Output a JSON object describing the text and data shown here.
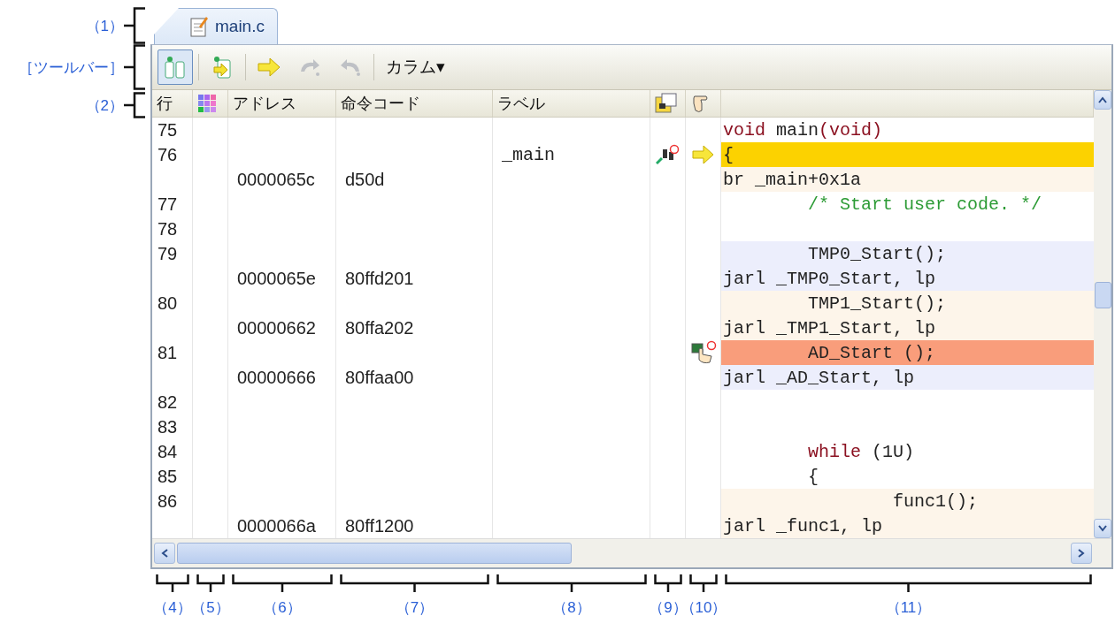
{
  "callouts_left": [
    "（1）",
    "［ツールバー］",
    "（2）"
  ],
  "tab": {
    "label": "main.c",
    "selected": true
  },
  "toolbar": [
    {
      "kind": "toggle",
      "selected": true,
      "disabled": false
    },
    {
      "kind": "button",
      "selected": false,
      "disabled": false
    },
    {
      "kind": "button",
      "selected": false,
      "disabled": false
    },
    {
      "kind": "button",
      "selected": false,
      "disabled": true
    },
    {
      "kind": "button",
      "selected": false,
      "disabled": true
    },
    {
      "kind": "menu",
      "label": "カラム",
      "caret": "▾",
      "selected": false,
      "disabled": false
    }
  ],
  "columns": [
    "行",
    "",
    "アドレス",
    "命令コード",
    "ラベル",
    "",
    "",
    ""
  ],
  "rows": [
    {
      "line": "75",
      "code": [
        {
          "t": "void",
          "kind": "keyword"
        },
        {
          "t": " main",
          "kind": "plain"
        },
        {
          "t": "(void)",
          "kind": "keyword"
        }
      ],
      "event": false,
      "current": false,
      "breakpoint": false
    },
    {
      "line": "76",
      "label": "_main",
      "code": [
        {
          "t": "{",
          "kind": "plain"
        }
      ],
      "color": "#fcd200",
      "event": true,
      "current": true,
      "breakpoint": false
    },
    {
      "address": "0000065c",
      "opcode": "d50d",
      "code": [
        {
          "t": "br _main+0x1a",
          "kind": "plain"
        }
      ],
      "color": "#fdf5ea",
      "event": false,
      "current": false,
      "breakpoint": false
    },
    {
      "line": "77",
      "code": [
        {
          "t": "        /* Start user code. */",
          "kind": "comment"
        }
      ],
      "event": false,
      "current": false,
      "breakpoint": false
    },
    {
      "line": "78",
      "event": false,
      "current": false,
      "breakpoint": false
    },
    {
      "line": "79",
      "code": [
        {
          "t": "        TMP0_Start();",
          "kind": "plain"
        }
      ],
      "color": "#eceefc",
      "event": false,
      "current": false,
      "breakpoint": false
    },
    {
      "address": "0000065e",
      "opcode": "80ffd201",
      "code": [
        {
          "t": "jarl _TMP0_Start, lp",
          "kind": "plain"
        }
      ],
      "color": "#eceefc",
      "event": false,
      "current": false,
      "breakpoint": false
    },
    {
      "line": "80",
      "code": [
        {
          "t": "        TMP1_Start();",
          "kind": "plain"
        }
      ],
      "color": "#fdf5ea",
      "event": false,
      "current": false,
      "breakpoint": false
    },
    {
      "address": "00000662",
      "opcode": "80ffa202",
      "code": [
        {
          "t": "jarl _TMP1_Start, lp",
          "kind": "plain"
        }
      ],
      "color": "#fdf5ea",
      "event": false,
      "current": false,
      "breakpoint": false
    },
    {
      "line": "81",
      "code": [
        {
          "t": "        AD_Start ();",
          "kind": "plain"
        }
      ],
      "color": "#f99d7b",
      "event": false,
      "current": false,
      "breakpoint": true
    },
    {
      "address": "00000666",
      "opcode": "80ffaa00",
      "code": [
        {
          "t": "jarl _AD_Start, lp",
          "kind": "plain"
        }
      ],
      "color": "#eceefc",
      "event": false,
      "current": false,
      "breakpoint": false
    },
    {
      "line": "82",
      "event": false,
      "current": false,
      "breakpoint": false
    },
    {
      "line": "83",
      "event": false,
      "current": false,
      "breakpoint": false
    },
    {
      "line": "84",
      "code": [
        {
          "t": "        while",
          "kind": "keyword"
        },
        {
          "t": " (1U)",
          "kind": "plain"
        }
      ],
      "event": false,
      "current": false,
      "breakpoint": false
    },
    {
      "line": "85",
      "code": [
        {
          "t": "        {",
          "kind": "plain"
        }
      ],
      "event": false,
      "current": false,
      "breakpoint": false
    },
    {
      "line": "86",
      "code": [
        {
          "t": "                func1();",
          "kind": "plain"
        }
      ],
      "color": "#fdf5ea",
      "event": false,
      "current": false,
      "breakpoint": false
    },
    {
      "address": "0000066a",
      "opcode": "80ff1200",
      "code": [
        {
          "t": "jarl _func1, lp",
          "kind": "plain"
        }
      ],
      "color": "#fdf5ea",
      "event": false,
      "current": false,
      "breakpoint": false
    }
  ],
  "callouts_bottom": [
    "（4）",
    "（5）",
    "（6）",
    "（7）",
    "（8）",
    "（9）",
    "（10）",
    "（11）"
  ]
}
